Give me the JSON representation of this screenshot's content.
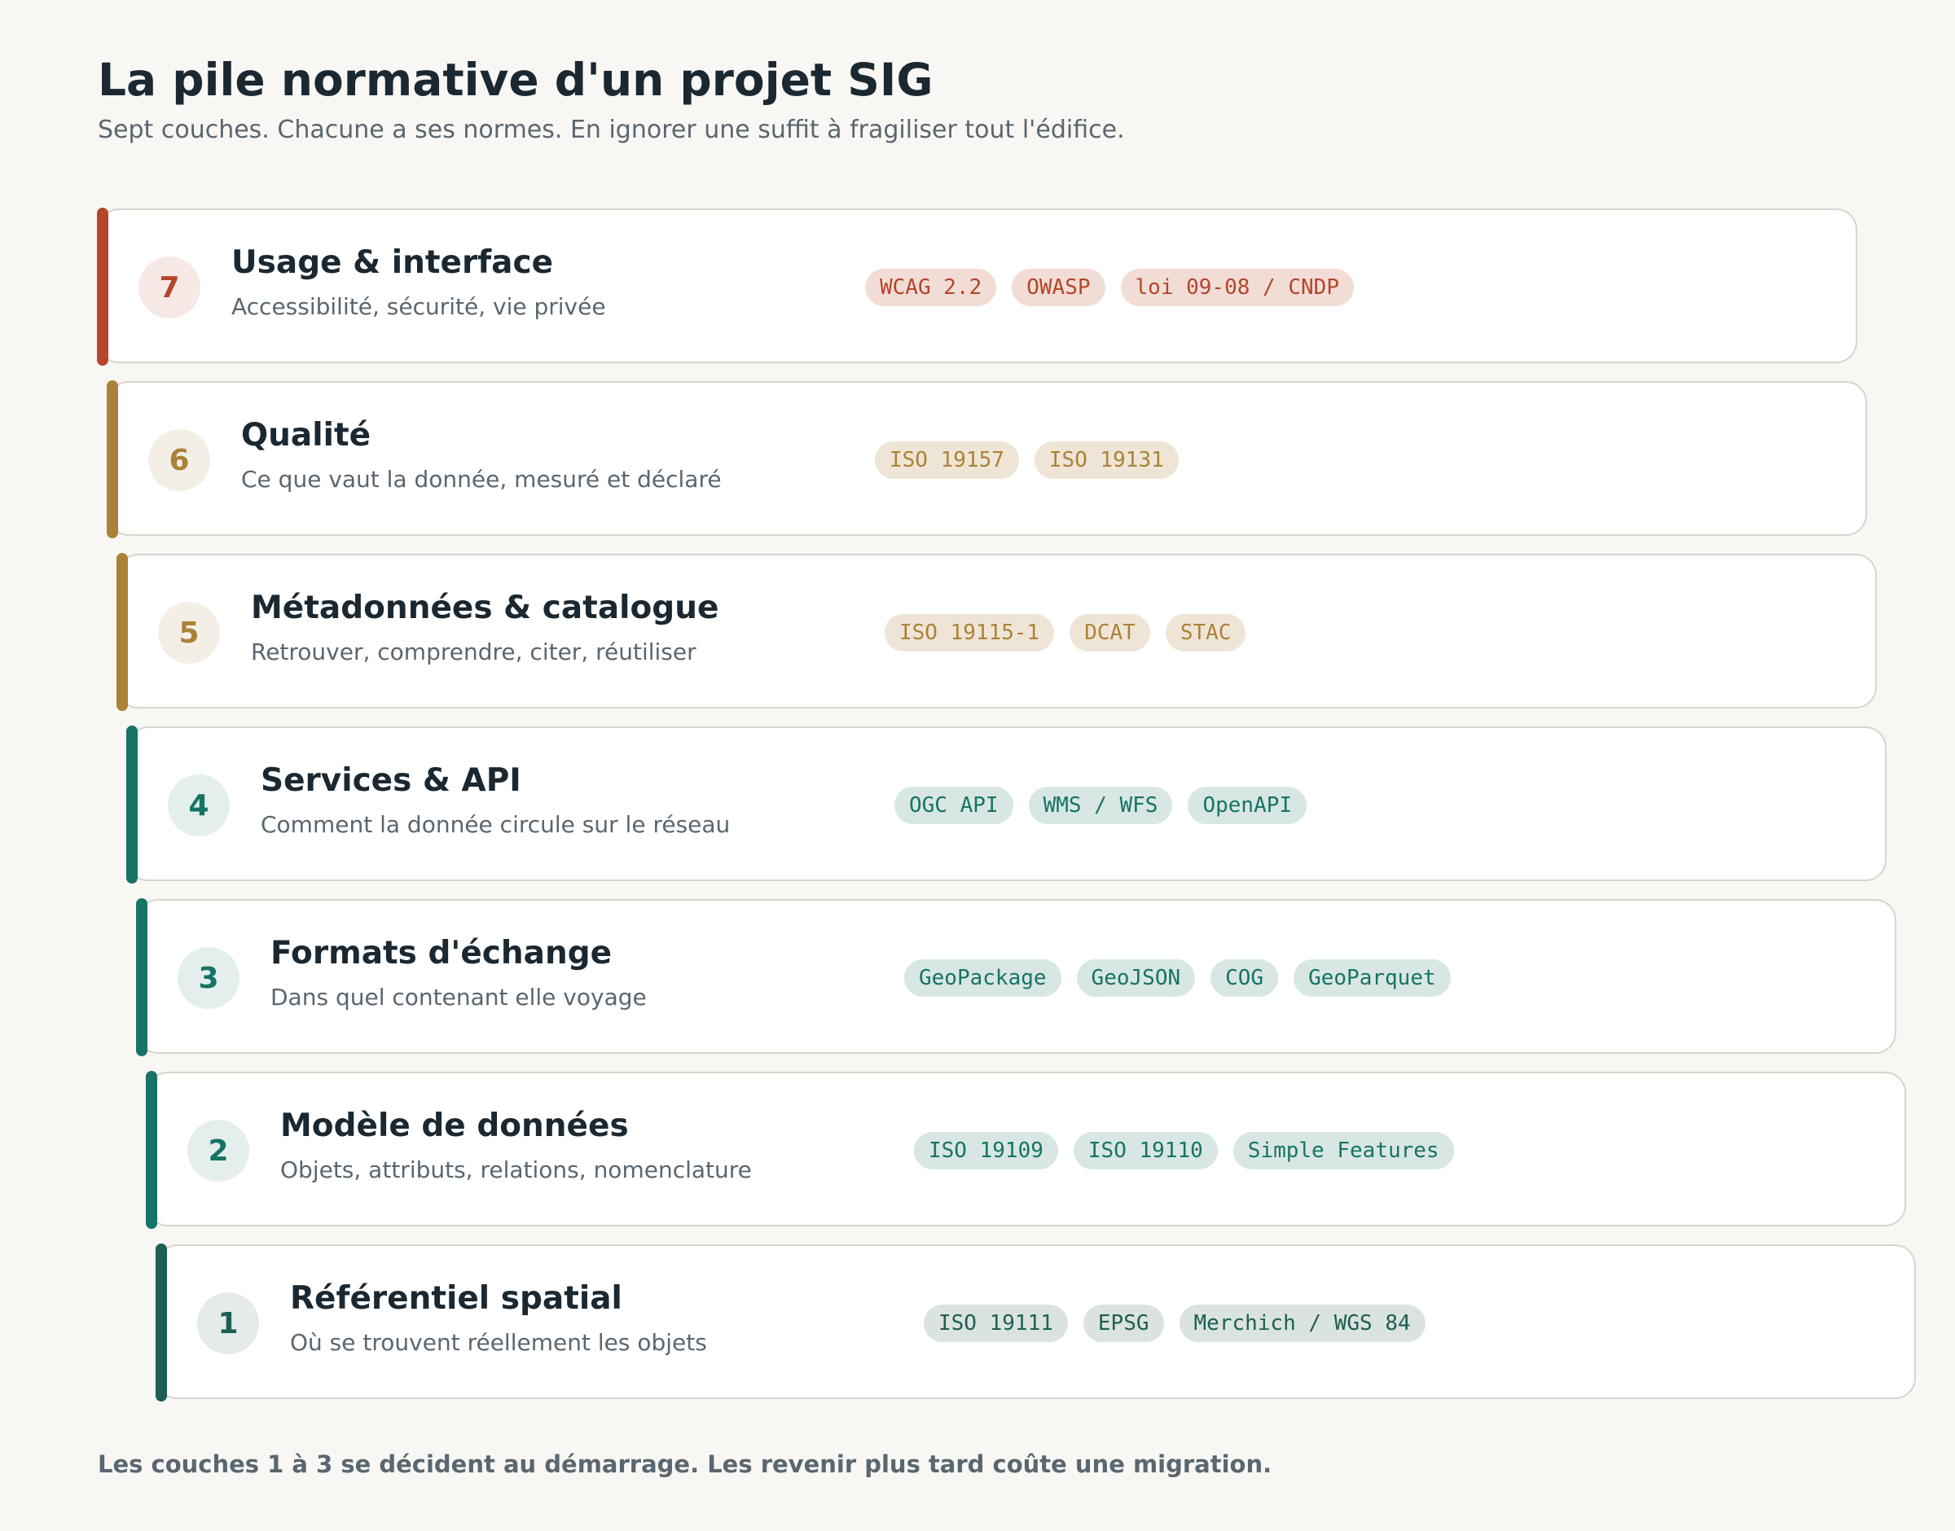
{
  "header": {
    "title": "La pile normative d'un projet SIG",
    "subtitle": "Sept couches. Chacune a ses normes. En ignorer une suffit à fragiliser tout l'édifice."
  },
  "layers": [
    {
      "number": "7",
      "title": "Usage & interface",
      "description": "Accessibilité, sécurité, vie privée",
      "tags": [
        "WCAG 2.2",
        "OWASP",
        "loi 09-08 / CNDP"
      ],
      "accent_color": "#b5462a",
      "circle_bg": "#f6e9e5",
      "tag_bg": "#f1ddd6",
      "tag_text": "#b5462a"
    },
    {
      "number": "6",
      "title": "Qualité",
      "description": "Ce que vaut la donnée, mesuré et déclaré",
      "tags": [
        "ISO 19157",
        "ISO 19131"
      ],
      "accent_color": "#ab8237",
      "circle_bg": "#f4efe6",
      "tag_bg": "#efe5d6",
      "tag_text": "#ab8237"
    },
    {
      "number": "5",
      "title": "Métadonnées & catalogue",
      "description": "Retrouver, comprendre, citer, réutiliser",
      "tags": [
        "ISO 19115-1",
        "DCAT",
        "STAC"
      ],
      "accent_color": "#ab8237",
      "circle_bg": "#f4efe6",
      "tag_bg": "#efe5d6",
      "tag_text": "#ab8237"
    },
    {
      "number": "4",
      "title": "Services & API",
      "description": "Comment la donnée circule sur le réseau",
      "tags": [
        "OGC API",
        "WMS / WFS",
        "OpenAPI"
      ],
      "accent_color": "#177366",
      "circle_bg": "#e4efed",
      "tag_bg": "#d8e7e3",
      "tag_text": "#177366"
    },
    {
      "number": "3",
      "title": "Formats d'échange",
      "description": "Dans quel contenant elle voyage",
      "tags": [
        "GeoPackage",
        "GeoJSON",
        "COG",
        "GeoParquet"
      ],
      "accent_color": "#177366",
      "circle_bg": "#e4efed",
      "tag_bg": "#d8e7e3",
      "tag_text": "#177366"
    },
    {
      "number": "2",
      "title": "Modèle de données",
      "description": "Objets, attributs, relations, nomenclature",
      "tags": [
        "ISO 19109",
        "ISO 19110",
        "Simple Features"
      ],
      "accent_color": "#177366",
      "circle_bg": "#e4efed",
      "tag_bg": "#d8e7e3",
      "tag_text": "#177366"
    },
    {
      "number": "1",
      "title": "Référentiel spatial",
      "description": "Où se trouvent réellement les objets",
      "tags": [
        "ISO 19111",
        "EPSG",
        "Merchich / WGS 84"
      ],
      "accent_color": "#1f5e54",
      "circle_bg": "#e4ebe9",
      "tag_bg": "#dae3df",
      "tag_text": "#1f5e54"
    }
  ],
  "footer": {
    "note": "Les couches 1 à 3 se décident au démarrage. Les revenir plus tard coûte une migration."
  }
}
